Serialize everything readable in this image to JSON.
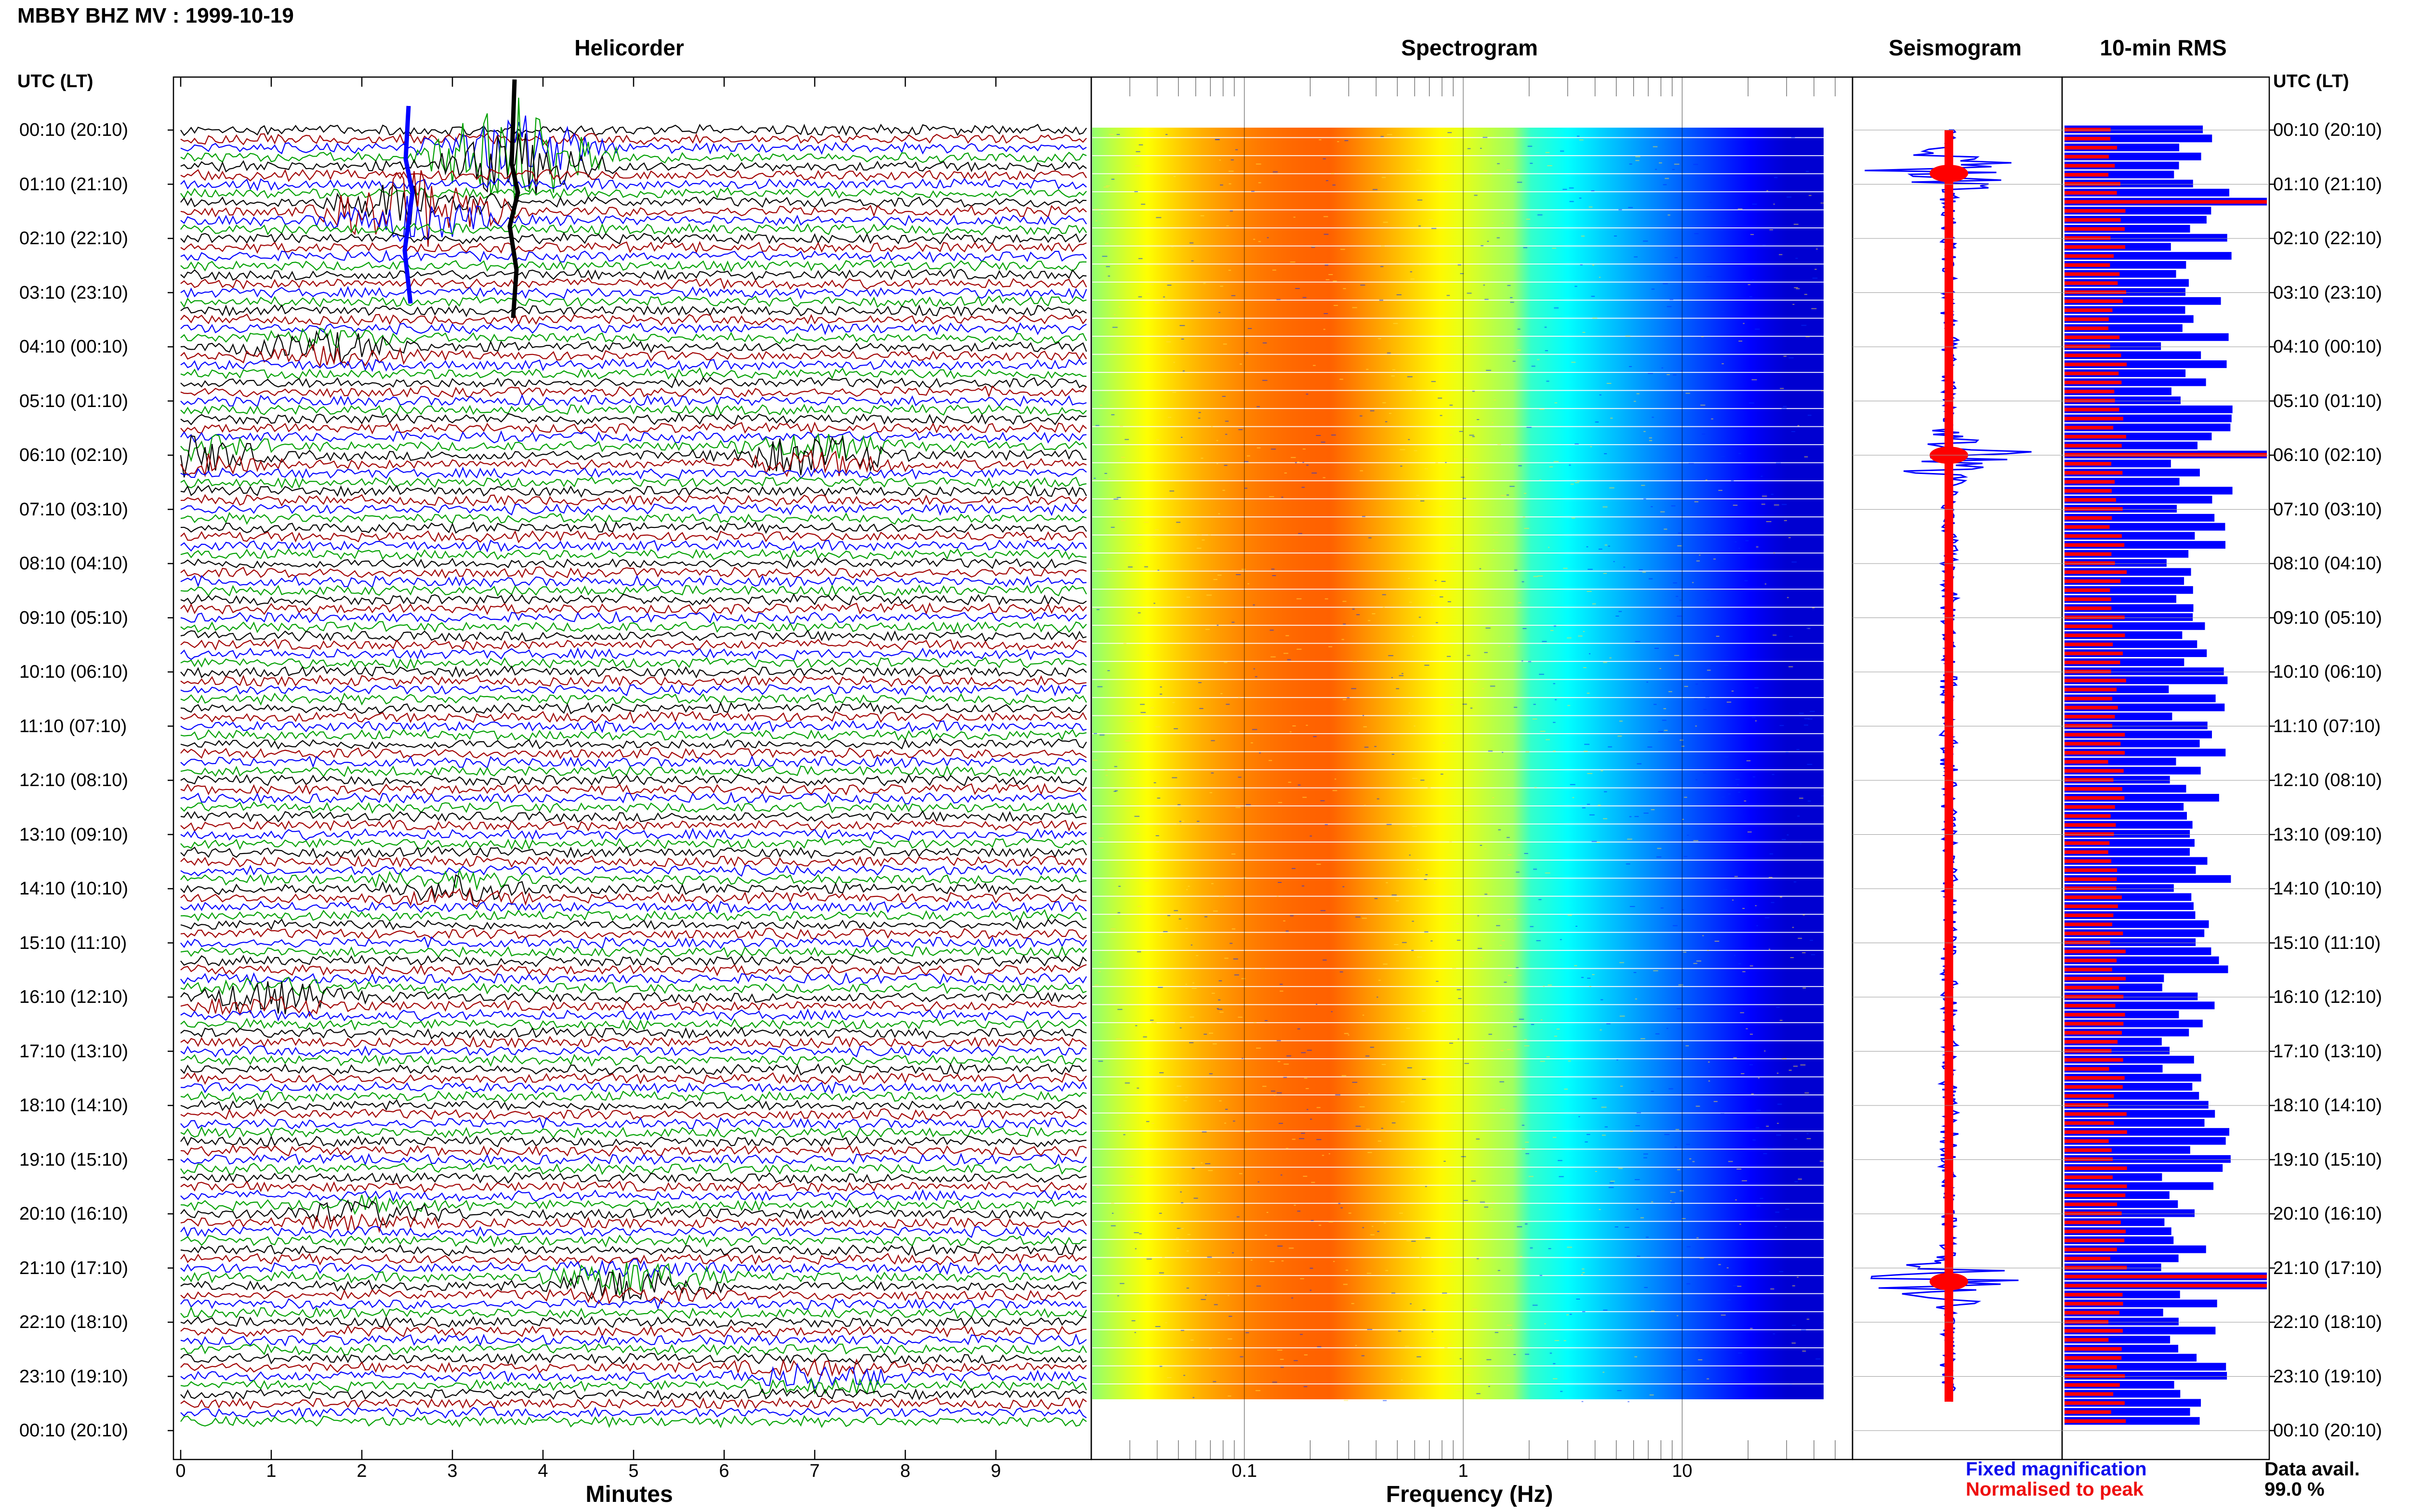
{
  "title": "MBBY BHZ MV : 1999-10-19",
  "panels": {
    "helicorder": "Helicorder",
    "spectrogram": "Spectrogram",
    "seismogram": "Seismogram",
    "rms": "10-min RMS"
  },
  "utc_label": "UTC (LT)",
  "time_labels": [
    "00:10 (20:10)",
    "01:10 (21:10)",
    "02:10 (22:10)",
    "03:10 (23:10)",
    "04:10 (00:10)",
    "05:10 (01:10)",
    "06:10 (02:10)",
    "07:10 (03:10)",
    "08:10 (04:10)",
    "09:10 (05:10)",
    "10:10 (06:10)",
    "11:10 (07:10)",
    "12:10 (08:10)",
    "13:10 (09:10)",
    "14:10 (10:10)",
    "15:10 (11:10)",
    "16:10 (12:10)",
    "17:10 (13:10)",
    "18:10 (14:10)",
    "19:10 (15:10)",
    "20:10 (16:10)",
    "21:10 (17:10)",
    "22:10 (18:10)",
    "23:10 (19:10)",
    "00:10 (20:10)"
  ],
  "legend": {
    "fixed": "Fixed magnification",
    "normalised": "Normalised to peak",
    "avail_label": "Data avail.",
    "avail_value": "99.0 %"
  },
  "colors": {
    "blue": "#0000ff",
    "red": "#ff0000",
    "green": "#00a000",
    "darkred": "#a00000",
    "black": "#000000"
  },
  "chart_data": [
    {
      "type": "line",
      "name": "helicorder",
      "xlabel": "Minutes",
      "x_ticks": [
        "0",
        "1",
        "2",
        "3",
        "4",
        "5",
        "6",
        "7",
        "8",
        "9"
      ],
      "xlim": [
        0,
        10
      ],
      "rows_per_hour": 6,
      "row_minutes": 10,
      "events": [
        {
          "hour": 0.5,
          "minute": 3.7,
          "amp": 9
        },
        {
          "hour": 1.5,
          "minute": 2.6,
          "amp": 6
        },
        {
          "hour": 4.0,
          "minute": 1.6,
          "amp": 2
        },
        {
          "hour": 6.0,
          "minute": 0.0,
          "amp": 3
        },
        {
          "hour": 6.0,
          "minute": 7.0,
          "amp": 3
        },
        {
          "hour": 14.0,
          "minute": 3.0,
          "amp": 1.5
        },
        {
          "hour": 16.0,
          "minute": 1.0,
          "amp": 2
        },
        {
          "hour": 20.0,
          "minute": 2.0,
          "amp": 1.5
        },
        {
          "hour": 21.25,
          "minute": 5.0,
          "amp": 3
        },
        {
          "hour": 23.0,
          "minute": 7.0,
          "amp": 1.5
        }
      ]
    },
    {
      "type": "heatmap",
      "name": "spectrogram",
      "xlabel": "Frequency (Hz)",
      "x_scale": "log",
      "x_ticks": [
        "0.1",
        "1",
        "10"
      ],
      "xlim": [
        0.02,
        60
      ],
      "peak_frequency_hz": 0.25
    },
    {
      "type": "line",
      "name": "seismogram",
      "events_hours": [
        0.8,
        6.0,
        21.25
      ]
    },
    {
      "type": "bar",
      "name": "10-min RMS",
      "series": [
        {
          "name": "Fixed magnification",
          "color": "#0000ff"
        },
        {
          "name": "Normalised to peak",
          "color": "#ff0000"
        }
      ],
      "peak_hours": [
        1.4,
        6.0,
        21.25
      ]
    }
  ]
}
